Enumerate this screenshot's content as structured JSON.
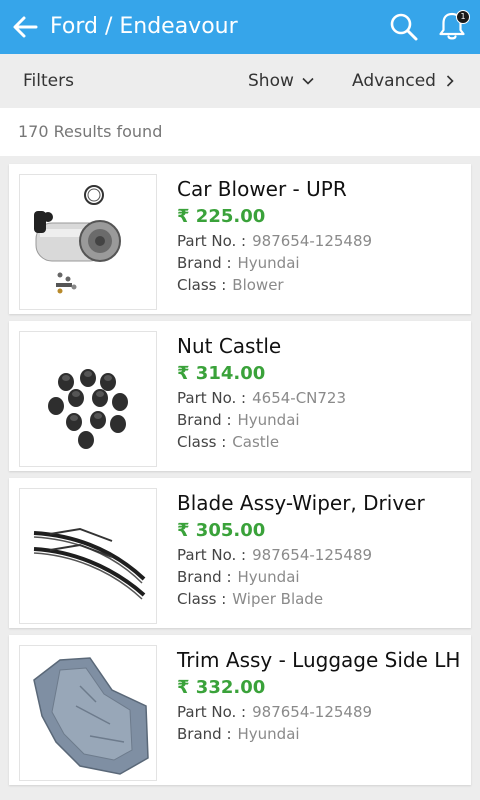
{
  "header": {
    "title": "Ford / Endeavour",
    "notification_count": "1",
    "bg_color": "#36a5ea"
  },
  "toolbar": {
    "filters_label": "Filters",
    "show_label": "Show",
    "advanced_label": "Advanced"
  },
  "results": {
    "count_text": "170 Results found"
  },
  "labels": {
    "part_no": "Part No. :",
    "brand": "Brand :",
    "class": "Class :"
  },
  "products": [
    {
      "name": "Car Blower - UPR",
      "price": "₹ 225.00",
      "part_no": "987654-125489",
      "brand": "Hyundai",
      "class": "Blower",
      "image": "air-suspension-strut"
    },
    {
      "name": "Nut Castle",
      "price": "₹ 314.00",
      "part_no": "4654-CN723",
      "brand": "Hyundai",
      "class": "Castle",
      "image": "rubber-bushings"
    },
    {
      "name": "Blade Assy-Wiper, Driver",
      "price": "₹ 305.00",
      "part_no": "987654-125489",
      "brand": "Hyundai",
      "class": "Wiper Blade",
      "image": "wiper-blades"
    },
    {
      "name": "Trim Assy - Luggage Side LH",
      "price": "₹ 332.00",
      "part_no": "987654-125489",
      "brand": "Hyundai",
      "image": "luggage-trim-panel"
    }
  ]
}
